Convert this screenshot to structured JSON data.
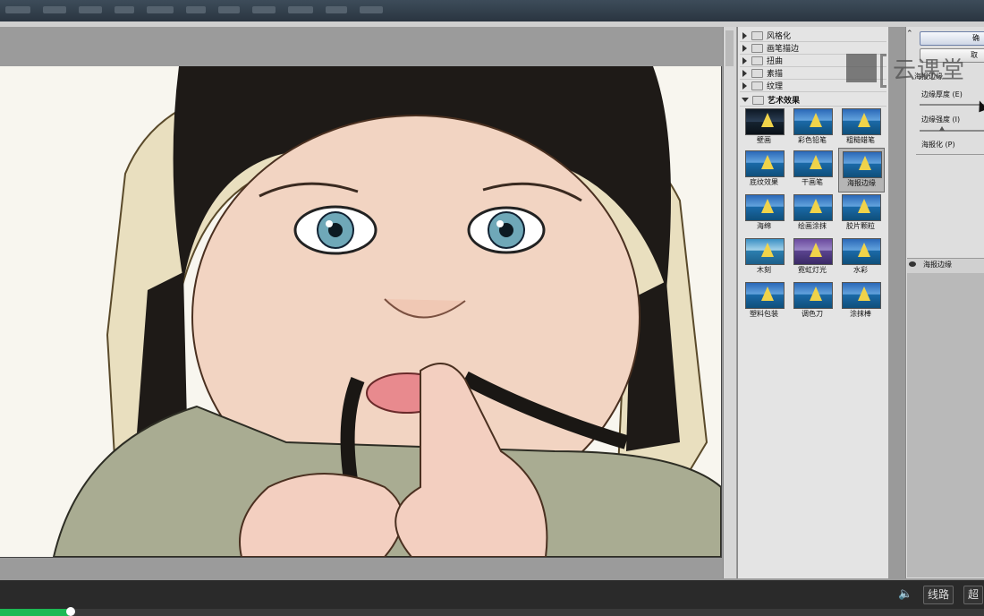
{
  "filter_categories": [
    {
      "label": "风格化",
      "open": false
    },
    {
      "label": "画笔描边",
      "open": false
    },
    {
      "label": "扭曲",
      "open": false
    },
    {
      "label": "素描",
      "open": false
    },
    {
      "label": "纹理",
      "open": false
    },
    {
      "label": "艺术效果",
      "open": true
    }
  ],
  "filters": [
    {
      "label": "壁画",
      "style": "dark"
    },
    {
      "label": "彩色铅笔",
      "style": "normal"
    },
    {
      "label": "粗糙蜡笔",
      "style": "normal"
    },
    {
      "label": "底纹效果",
      "style": "normal"
    },
    {
      "label": "干画笔",
      "style": "normal"
    },
    {
      "label": "海报边缘",
      "style": "normal",
      "selected": true
    },
    {
      "label": "海绵",
      "style": "normal"
    },
    {
      "label": "绘画涂抹",
      "style": "normal"
    },
    {
      "label": "胶片颗粒",
      "style": "normal"
    },
    {
      "label": "木刻",
      "style": "paint"
    },
    {
      "label": "霓虹灯光",
      "style": "purple"
    },
    {
      "label": "水彩",
      "style": "normal"
    },
    {
      "label": "塑料包装",
      "style": "normal"
    },
    {
      "label": "调色刀",
      "style": "normal"
    },
    {
      "label": "涂抹棒",
      "style": "normal"
    }
  ],
  "dialog": {
    "ok_label": "确",
    "cancel_label": "取",
    "filter_name": "海报边缘",
    "params": [
      {
        "label": "边缘厚度 (E)",
        "value_fraction": 0.95
      },
      {
        "label": "边缘强度 (I)",
        "value_fraction": 0.3
      },
      {
        "label": "海报化 (P)",
        "value_fraction": null
      }
    ]
  },
  "layer": {
    "label": "海报边缘"
  },
  "watermark": {
    "text": "云课堂"
  },
  "player": {
    "progress_fraction": 0.07,
    "line_button": "线路",
    "quality_button": "超"
  },
  "colors": {
    "accent": "#1db954",
    "panel": "#e4e4e4"
  }
}
